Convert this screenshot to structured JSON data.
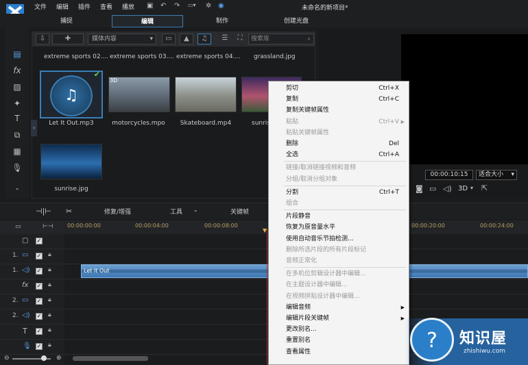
{
  "menubar": {
    "items": [
      "文件",
      "编辑",
      "插件",
      "查看",
      "播放"
    ],
    "title": "未命名的新项目*"
  },
  "tabs": [
    "捕捉",
    "编辑",
    "制作",
    "创建光盘"
  ],
  "library": {
    "media_select": "媒体内容",
    "search_placeholder": "搜索库",
    "top_labels": [
      "extreme sports 02....",
      "extreme sports 03....",
      "extreme sports 04....",
      "grassland.jpg"
    ],
    "items": [
      "Let It Out.mp3",
      "motorcycles.mpo",
      "Skateboard.mp4",
      "sunris",
      "sunrise.jpg"
    ],
    "badge_3d": "3D"
  },
  "preview": {
    "timecode": "00:00:10:15",
    "fit": "适合大小",
    "mode_3d": "3D"
  },
  "toolbar": {
    "fix": "修复/增强",
    "tools": "工具",
    "keyframe": "关键帧"
  },
  "ruler": [
    "00:00:00:00",
    "00:00:04:00",
    "00:00:08:00",
    "00:00:20:00",
    "00:00:24:00"
  ],
  "tracks": {
    "labels": [
      "1.",
      "1.",
      "fx",
      "2.",
      "2.",
      "T",
      ""
    ],
    "clip": "Let It Out"
  },
  "context_menu": [
    {
      "label": "剪切",
      "shortcut": "Ctrl+X",
      "enabled": true
    },
    {
      "label": "复制",
      "shortcut": "Ctrl+C",
      "enabled": true
    },
    {
      "label": "复制关键帧属性",
      "shortcut": "",
      "enabled": true
    },
    {
      "label": "粘贴",
      "shortcut": "Ctrl+V",
      "enabled": false,
      "submenu": true
    },
    {
      "label": "粘贴关键帧属性",
      "shortcut": "",
      "enabled": false
    },
    {
      "label": "删除",
      "shortcut": "Del",
      "enabled": true
    },
    {
      "label": "全选",
      "shortcut": "Ctrl+A",
      "enabled": true
    },
    {
      "label": "链接/取消链接视频和音频",
      "shortcut": "",
      "enabled": false,
      "sep": true
    },
    {
      "label": "分组/取消分组对象",
      "shortcut": "",
      "enabled": false
    },
    {
      "label": "分割",
      "shortcut": "Ctrl+T",
      "enabled": true,
      "sep": true
    },
    {
      "label": "组合",
      "shortcut": "",
      "enabled": false
    },
    {
      "label": "片段静音",
      "shortcut": "",
      "enabled": true,
      "sep": true
    },
    {
      "label": "恢复为原音量水平",
      "shortcut": "",
      "enabled": true
    },
    {
      "label": "使用自动音乐节拍检测...",
      "shortcut": "",
      "enabled": true
    },
    {
      "label": "删除所选片段的所有片段标记",
      "shortcut": "",
      "enabled": false
    },
    {
      "label": "音频正常化",
      "shortcut": "",
      "enabled": false
    },
    {
      "label": "在多机位剪辑设计器中编辑...",
      "shortcut": "",
      "enabled": false,
      "sep": true
    },
    {
      "label": "在主题设计器中编辑...",
      "shortcut": "",
      "enabled": false
    },
    {
      "label": "在视频拼贴设计器中编辑...",
      "shortcut": "",
      "enabled": false
    },
    {
      "label": "编辑音频",
      "shortcut": "",
      "enabled": true,
      "submenu": true
    },
    {
      "label": "编辑片段关键帧",
      "shortcut": "",
      "enabled": true,
      "submenu": true
    },
    {
      "label": "更改别名...",
      "shortcut": "",
      "enabled": true
    },
    {
      "label": "重置别名",
      "shortcut": "",
      "enabled": true
    },
    {
      "label": "查看属性",
      "shortcut": "",
      "enabled": true
    }
  ],
  "watermark": {
    "name": "知识屋",
    "url": "zhishiwu.com"
  }
}
